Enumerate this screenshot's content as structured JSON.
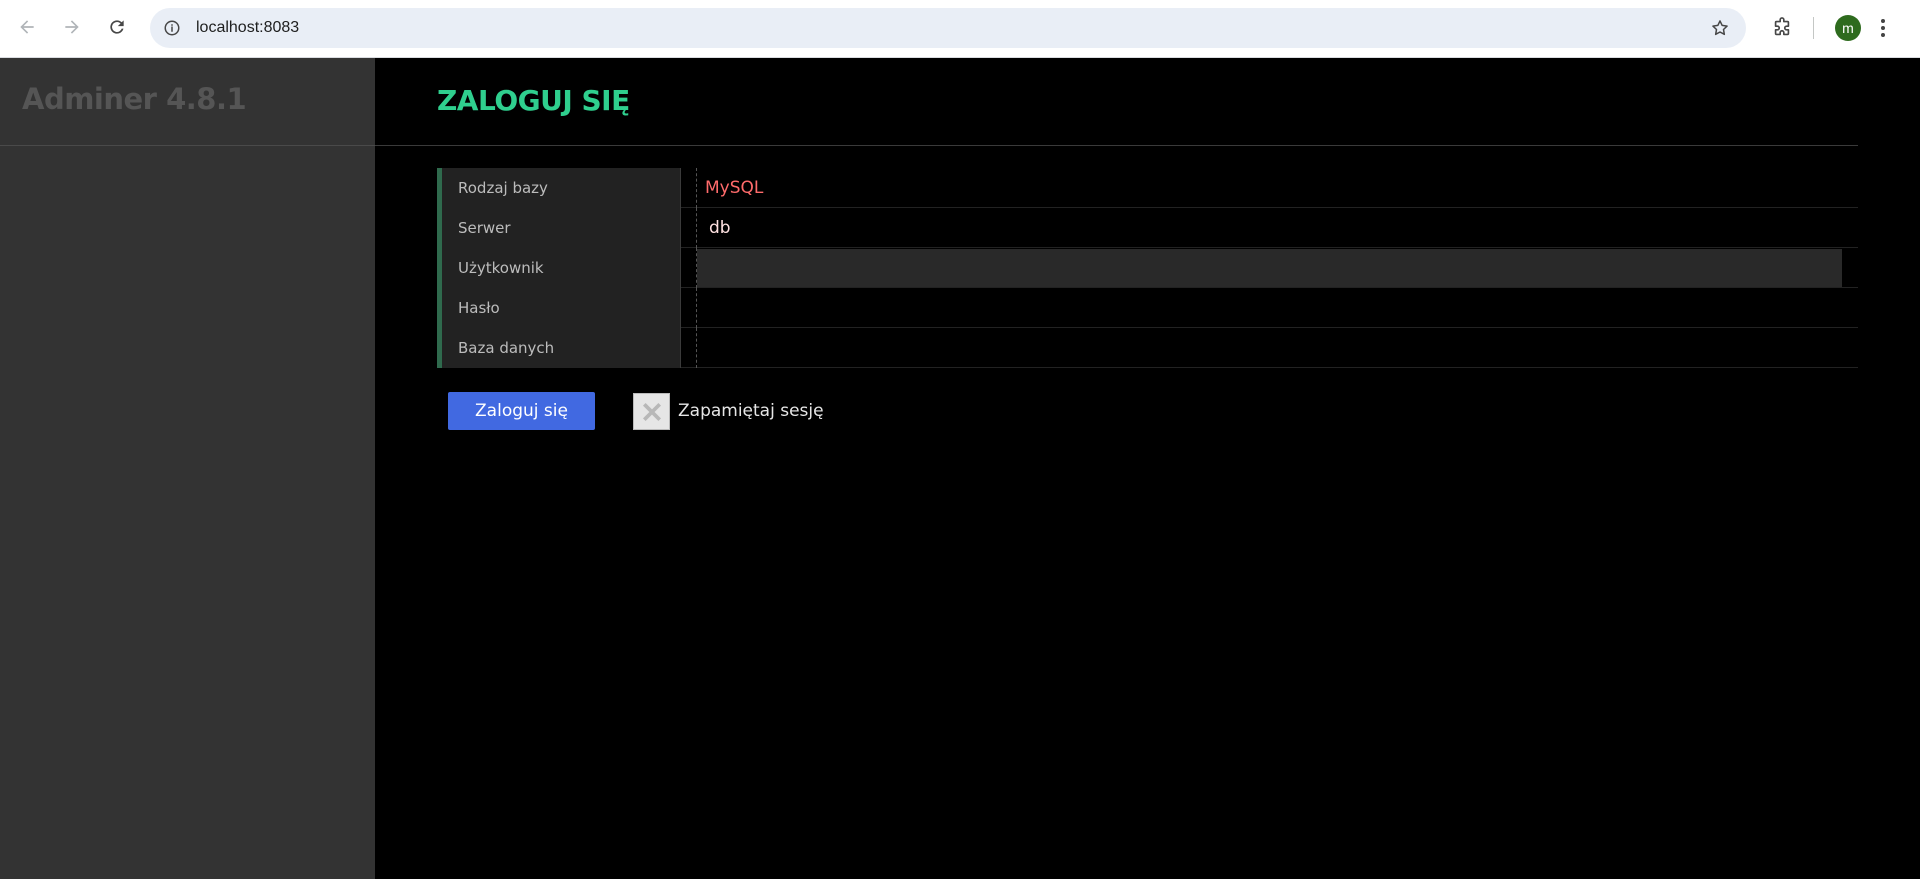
{
  "browser": {
    "url": "localhost:8083",
    "profile_initial": "m",
    "profile_color": "#2e6b1e"
  },
  "menu": {
    "brand": "Adminer 4.8.1"
  },
  "page": {
    "title": "ZALOGUJ SIĘ",
    "title_color": "#2fcf8e"
  },
  "form": {
    "fields": [
      {
        "label": "Rodzaj bazy",
        "value": "MySQL",
        "kind": "select"
      },
      {
        "label": "Serwer",
        "value": "db",
        "kind": "input"
      },
      {
        "label": "Użytkownik",
        "value": "",
        "kind": "input"
      },
      {
        "label": "Hasło",
        "value": "",
        "kind": "password"
      },
      {
        "label": "Baza danych",
        "value": "",
        "kind": "input"
      }
    ],
    "submit_label": "Zaloguj się",
    "remember_label": "Zapamiętaj sesję"
  },
  "colors": {
    "accent_button": "#4169e1",
    "select_text": "#ff6b6b"
  }
}
